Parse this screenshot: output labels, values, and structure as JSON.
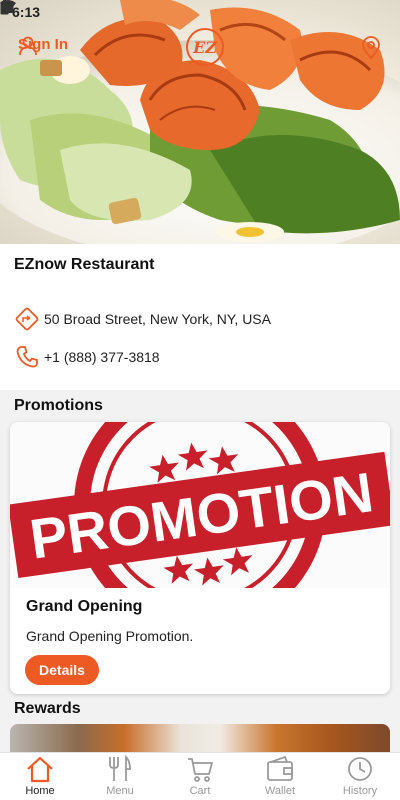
{
  "status_bar": {
    "time": "6:13",
    "icons": [
      "gear-icon",
      "navigation-icon",
      "play-protect-icon",
      "warning-icon"
    ],
    "right_icons": [
      "wifi-icon",
      "signal-icon",
      "battery-icon"
    ]
  },
  "header": {
    "sign_in_label": "Sign In",
    "logo_text": "EZ",
    "accent_color": "#ee5a24"
  },
  "restaurant": {
    "name": "EZnow Restaurant",
    "address": "50 Broad Street, New York, NY, USA",
    "phone": "+1 (888) 377-3818"
  },
  "promotions": {
    "section_title": "Promotions",
    "items": [
      {
        "image_text": "PROMOTION",
        "title": "Grand Opening",
        "description": "Grand Opening Promotion.",
        "button_label": "Details"
      }
    ]
  },
  "rewards": {
    "section_title": "Rewards"
  },
  "bottom_nav": {
    "items": [
      {
        "label": "Home",
        "icon": "home-icon",
        "active": true
      },
      {
        "label": "Menu",
        "icon": "utensils-icon",
        "active": false
      },
      {
        "label": "Cart",
        "icon": "cart-icon",
        "active": false
      },
      {
        "label": "Wallet",
        "icon": "wallet-icon",
        "active": false
      },
      {
        "label": "History",
        "icon": "history-icon",
        "active": false
      }
    ]
  }
}
